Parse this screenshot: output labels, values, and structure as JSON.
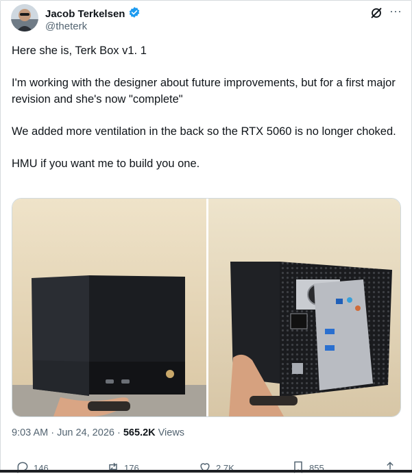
{
  "author": {
    "display_name": "Jacob Terkelsen",
    "handle": "@theterk",
    "verified_icon": "verified-badge-icon",
    "verified_color": "#1d9bf0"
  },
  "header_icons": [
    "grok-icon",
    "more-icon"
  ],
  "tweet": {
    "paragraphs": [
      "Here she is, Terk Box v1. 1",
      "I'm working with the designer about future improvements, but for a first major revision and she's now \"complete\"",
      "We added more ventilation in the back so the RTX 5060 is no longer choked.",
      "HMU if you want me to build you one."
    ]
  },
  "media": {
    "count": 2,
    "photos": [
      "front-view-photo",
      "back-view-photo"
    ]
  },
  "meta": {
    "time": "9:03 AM",
    "separator": " · ",
    "date": "Jun 24, 2026",
    "views_count": "565.2K",
    "views_label": " Views"
  },
  "actions": {
    "replies": "146",
    "reposts": "176",
    "likes": "2.7K",
    "bookmarks": "855"
  },
  "colors": {
    "text": "#0f1419",
    "secondary": "#536471",
    "accent": "#1d9bf0"
  }
}
